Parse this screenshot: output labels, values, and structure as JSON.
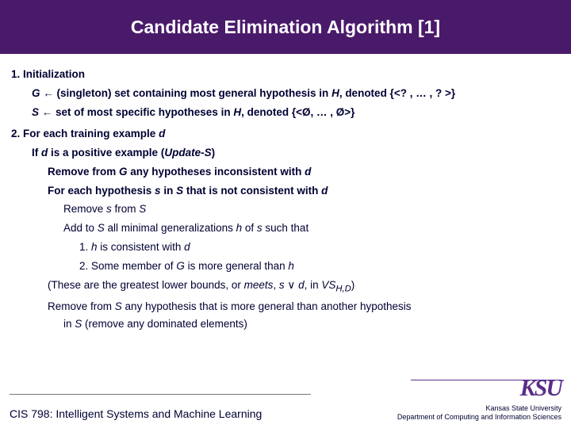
{
  "header": {
    "title": "Candidate Elimination Algorithm [1]"
  },
  "section1": {
    "heading": "1. Initialization",
    "lineG_pre": "G",
    "lineG_arrow": " ← (singleton) set containing most general hypothesis in ",
    "lineG_H": "H",
    "lineG_post": ", denoted {<? , … , ? >}",
    "lineS_pre": "S",
    "lineS_arrow": " ← set of most specific hypotheses in ",
    "lineS_H": "H",
    "lineS_post": ", denoted {<Ø, … , Ø>}"
  },
  "section2": {
    "heading_pre": "2. For each training example ",
    "heading_d": "d",
    "if_pre": "If ",
    "if_d": "d",
    "if_mid": " is a positive example (",
    "if_upd": "Update-S",
    "if_post": ")",
    "rm_pre": "Remove from ",
    "rm_G": "G",
    "rm_mid": " any hypotheses inconsistent with ",
    "rm_d": "d",
    "foreach_pre": "For each hypothesis ",
    "foreach_s": "s",
    "foreach_mid": " in ",
    "foreach_S": "S",
    "foreach_mid2": " that is not consistent with ",
    "foreach_d": "d",
    "sub_remove_pre": "Remove ",
    "sub_remove_s": "s",
    "sub_remove_mid": " from ",
    "sub_remove_S": "S",
    "sub_add_pre": "Add to ",
    "sub_add_S": "S",
    "sub_add_mid": " all minimal generalizations ",
    "sub_add_h": "h",
    "sub_add_mid2": " of ",
    "sub_add_s": "s",
    "sub_add_post": " such that",
    "cond1_pre": "1. ",
    "cond1_h": "h",
    "cond1_mid": " is consistent with ",
    "cond1_d": "d",
    "cond2_pre": "2. Some member of ",
    "cond2_G": "G",
    "cond2_mid": " is more general than ",
    "cond2_h": "h",
    "meets_pre": "(These are the greatest lower bounds, or ",
    "meets_em": "meets",
    "meets_mid": ", ",
    "meets_s": "s",
    "meets_or": " ∨ ",
    "meets_d": "d",
    "meets_mid2": ", in ",
    "meets_vs": "VS",
    "meets_sub": "H,D",
    "meets_post": ")",
    "dom_pre": "Remove from ",
    "dom_S": "S",
    "dom_mid": " any hypothesis that is more general than another hypothesis",
    "dom_line2_pre": "in ",
    "dom_line2_S": "S",
    "dom_line2_post": " (remove any dominated elements)"
  },
  "footer": {
    "left": "CIS 798: Intelligent Systems and Machine Learning",
    "logo": "KSU",
    "uni": "Kansas State University",
    "dept": "Department of Computing and Information Sciences"
  }
}
